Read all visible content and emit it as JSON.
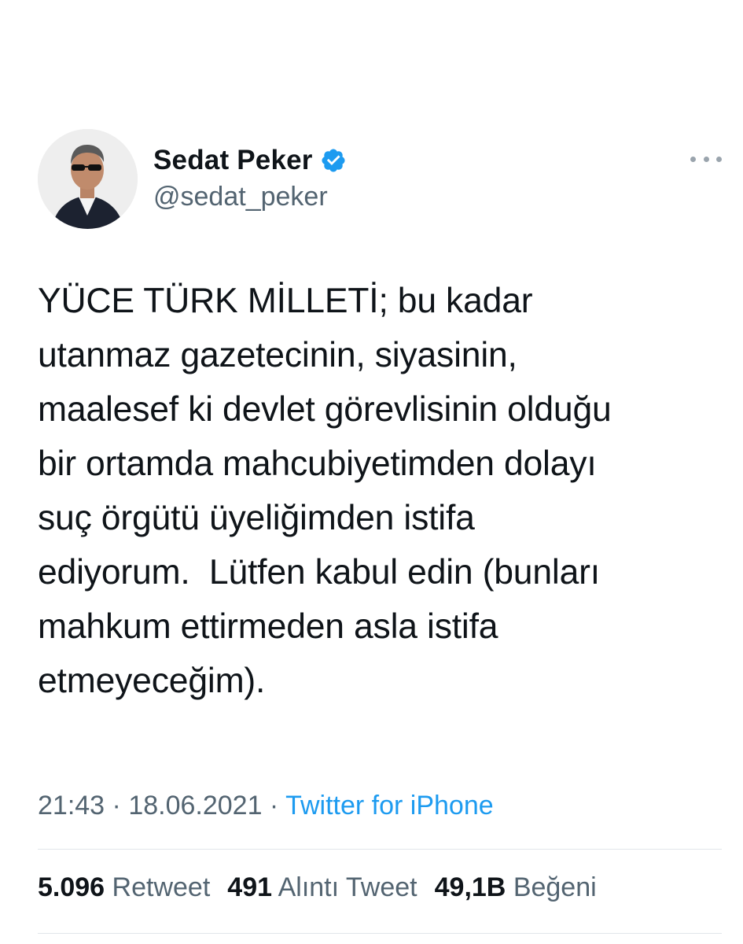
{
  "user": {
    "display_name": "Sedat Peker",
    "handle": "@sedat_peker",
    "verified": true,
    "avatar_icon": "profile-photo"
  },
  "tweet": {
    "text_lines": [
      "YÜCE TÜRK MİLLETİ; bu kadar",
      "utanmaz gazetecinin, siyasinin,",
      "maalesef ki devlet görevlisinin olduğu",
      "bir ortamda mahcubiyetimden dolayı",
      "suç örgütü üyeliğimden istifa",
      "ediyorum.  Lütfen kabul edin (bunları",
      "mahkum ettirmeden asla istifa",
      "etmeyeceğim)."
    ],
    "time": "21:43",
    "separator": " · ",
    "date": "18.06.2021",
    "source": "Twitter for iPhone"
  },
  "stats": {
    "retweets": {
      "count": "5.096",
      "label": "Retweet"
    },
    "quotes": {
      "count": "491",
      "label": "Alıntı Tweet"
    },
    "likes": {
      "count": "49,1B",
      "label": "Beğeni"
    }
  },
  "colors": {
    "primary_text": "#0f1419",
    "secondary_text": "#536471",
    "link": "#1d9bf0",
    "verified_badge": "#1d9bf0",
    "divider": "#e1e6ea"
  },
  "icons": {
    "more": "more-horizontal-icon",
    "verified": "verified-badge-icon"
  }
}
